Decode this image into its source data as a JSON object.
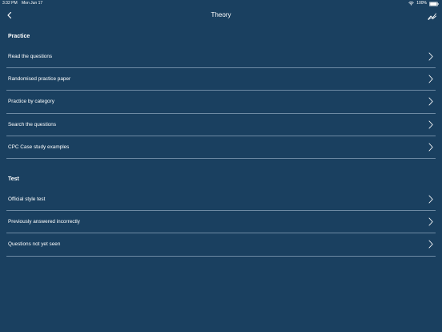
{
  "status_bar": {
    "time": "3:32 PM",
    "date": "Mon Jun 17",
    "battery": "100%"
  },
  "nav": {
    "title": "Theory",
    "back_icon": "chevron-left-icon",
    "right_icon": "stats-chart-icon"
  },
  "sections": [
    {
      "header": "Practice",
      "items": [
        {
          "label": "Read the questions"
        },
        {
          "label": "Randomised practice paper"
        },
        {
          "label": "Practice by category"
        },
        {
          "label": "Search the questions"
        },
        {
          "label": "CPC Case study examples"
        }
      ]
    },
    {
      "header": "Test",
      "items": [
        {
          "label": "Official style test"
        },
        {
          "label": "Previously answered incorrectly"
        },
        {
          "label": "Questions not yet seen"
        }
      ]
    }
  ],
  "colors": {
    "background": "#1a4060",
    "divider": "#6d8aa3",
    "text": "#ffffff"
  }
}
